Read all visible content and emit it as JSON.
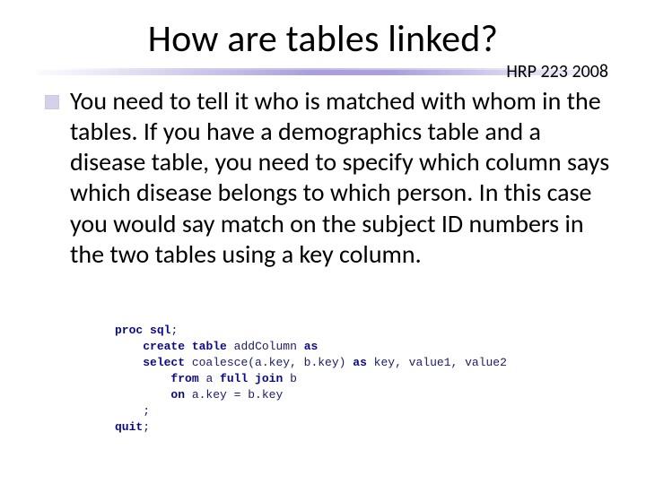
{
  "title": "How are tables linked?",
  "course_tag": "HRP 223 2008",
  "bullet": "You need to tell it who is matched with whom in the tables.  If you have a demographics table and a disease table, you need to specify which column says which disease belongs to which person. In this case you would say match on the subject ID numbers in the two tables using a key column.",
  "code": {
    "l1a": "proc",
    "l1b": " ",
    "l1c": "sql",
    "l1d": ";",
    "l2a": "    ",
    "l2b": "create",
    "l2c": " ",
    "l2d": "table",
    "l2e": " addColumn ",
    "l2f": "as",
    "l3a": "    ",
    "l3b": "select",
    "l3c": " coalesce(a.key, b.key) ",
    "l3d": "as",
    "l3e": " key, value1, value2",
    "l4a": "        ",
    "l4b": "from",
    "l4c": " a ",
    "l4d": "full join",
    "l4e": " b",
    "l5a": "        ",
    "l5b": "on",
    "l5c": " a.key = b.key",
    "l6": "    ;",
    "l7a": "quit",
    "l7b": ";"
  }
}
